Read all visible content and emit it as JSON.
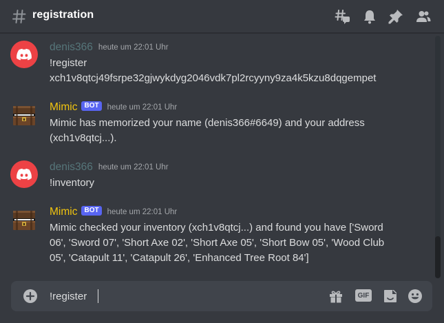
{
  "header": {
    "channel_name": "registration",
    "icons": [
      "hash-icon",
      "threads-icon",
      "notification-bell-icon",
      "pin-icon",
      "member-list-icon"
    ]
  },
  "messages": [
    {
      "author": "denis366",
      "timestamp": "heute um 22:01 Uhr",
      "avatar": "discord-logo-icon",
      "lines": [
        "!register",
        "xch1v8qtcj49fsrpe32gjwykdyg2046vdk7pl2rcyyny9za4k5kzu8dqgempet"
      ]
    },
    {
      "author": "Mimic",
      "bot_tag": "BOT",
      "timestamp": "heute um 22:01 Uhr",
      "avatar": "treasure-chest-icon",
      "lines": [
        "Mimic has memorized your name (denis366#6649) and your address",
        "(xch1v8qtcj...)."
      ]
    },
    {
      "author": "denis366",
      "timestamp": "heute um 22:01 Uhr",
      "avatar": "discord-logo-icon",
      "lines": [
        "!inventory"
      ]
    },
    {
      "author": "Mimic",
      "bot_tag": "BOT",
      "timestamp": "heute um 22:01 Uhr",
      "avatar": "treasure-chest-icon",
      "lines": [
        "Mimic checked your inventory (xch1v8qtcj...) and found you have ['Sword",
        "06', 'Sword 07', 'Short Axe 02', 'Short Axe 05', 'Short Bow 05', 'Wood Club",
        "05', 'Catapult 11', 'Catapult 26', 'Enhanced Tree Root 84']"
      ]
    }
  ],
  "composer": {
    "value": "!register",
    "gif_label": "GIF",
    "icons": [
      "add-attachment-icon",
      "gift-icon",
      "gif-icon",
      "sticker-icon",
      "emoji-icon"
    ]
  },
  "colors": {
    "background": "#36393f",
    "composer_bg": "#40444b",
    "user_name": "#56767a",
    "bot_name": "#f1c40f",
    "bot_tag": "#5865f2",
    "discord_red": "#ed4245"
  }
}
